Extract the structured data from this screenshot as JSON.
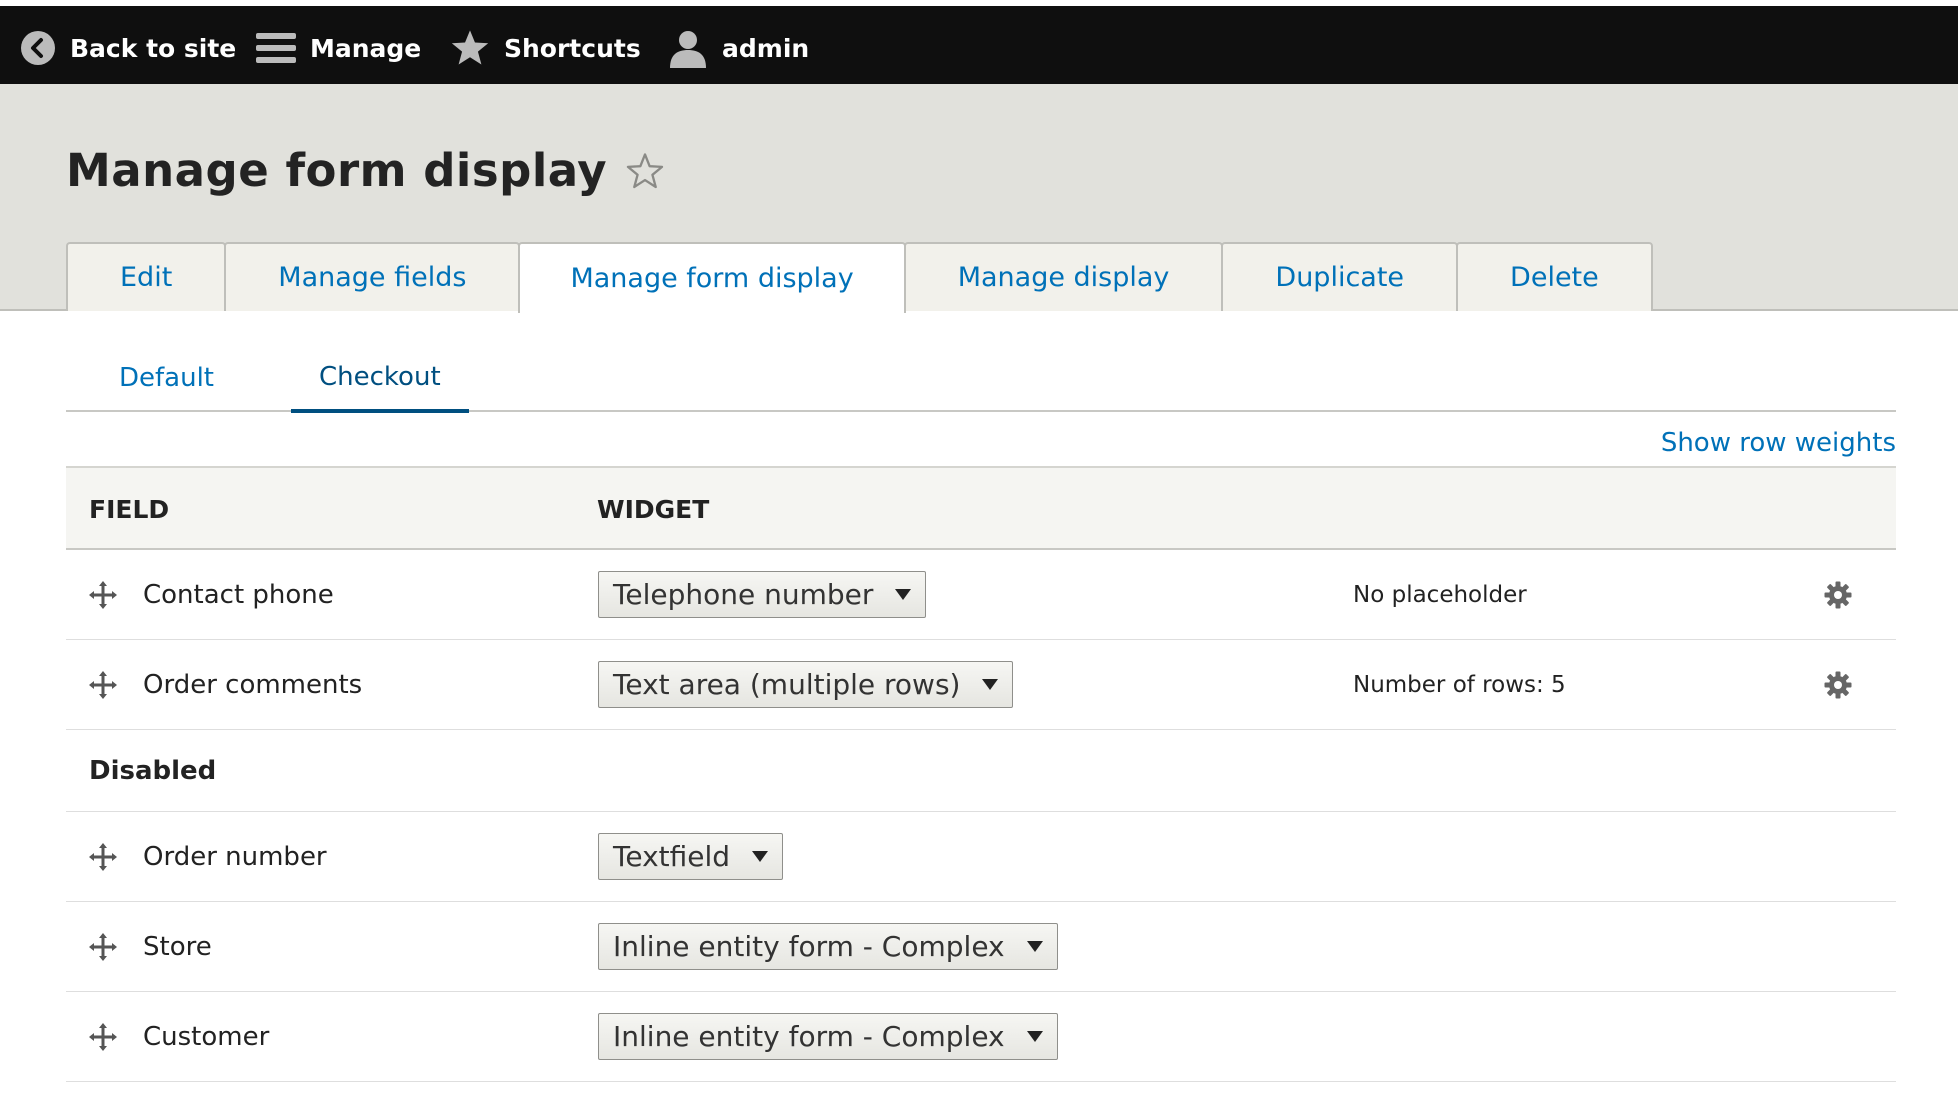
{
  "toolbar": {
    "back_label": "Back to site",
    "manage_label": "Manage",
    "shortcuts_label": "Shortcuts",
    "user_label": "admin"
  },
  "page": {
    "title": "Manage form display"
  },
  "tabs": [
    {
      "label": "Edit"
    },
    {
      "label": "Manage fields"
    },
    {
      "label": "Manage form display",
      "active": true
    },
    {
      "label": "Manage display"
    },
    {
      "label": "Duplicate"
    },
    {
      "label": "Delete"
    }
  ],
  "subtabs": [
    {
      "label": "Default"
    },
    {
      "label": "Checkout",
      "active": true
    }
  ],
  "row_weights_label": "Show row weights",
  "table": {
    "headers": {
      "field": "FIELD",
      "widget": "WIDGET"
    },
    "rows": [
      {
        "field": "Contact phone",
        "widget": "Telephone number",
        "summary": "No placeholder"
      },
      {
        "field": "Order comments",
        "widget": "Text area (multiple rows)",
        "summary": "Number of rows: 5"
      }
    ],
    "disabled_region_title": "Disabled",
    "disabled_rows": [
      {
        "field": "Order number",
        "widget": "Textfield"
      },
      {
        "field": "Store",
        "widget": "Inline entity form - Complex"
      },
      {
        "field": "Customer",
        "widget": "Inline entity form - Complex"
      }
    ]
  },
  "colors": {
    "link": "#0071b8",
    "toolbar_bg": "#0f0f0f",
    "header_bg": "#e1e1dc"
  },
  "icons": {
    "back": "chevron-left-circle-icon",
    "manage": "hamburger-icon",
    "shortcuts": "star-icon",
    "user": "user-icon",
    "favorite": "star-outline-icon",
    "drag": "move-icon",
    "settings": "gear-icon"
  }
}
